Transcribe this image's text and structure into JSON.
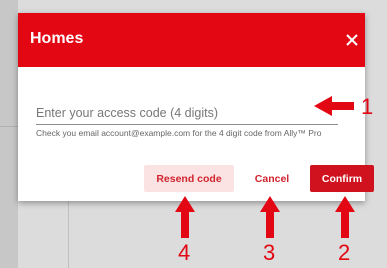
{
  "dialog": {
    "title": "Homes",
    "close_icon": "close-icon",
    "input": {
      "placeholder": "Enter your access code (4 digits)",
      "value": ""
    },
    "helper_text": "Check you email account@example.com for the 4 digit code from Ally™ Pro",
    "buttons": {
      "resend": "Resend code",
      "cancel": "Cancel",
      "confirm": "Confirm"
    }
  },
  "annotations": {
    "labels": [
      "1",
      "2",
      "3",
      "4"
    ],
    "color": "#e30613"
  },
  "colors": {
    "header": "#e30613",
    "accent": "#d0121f",
    "resend_bg": "#fbe3e3"
  }
}
